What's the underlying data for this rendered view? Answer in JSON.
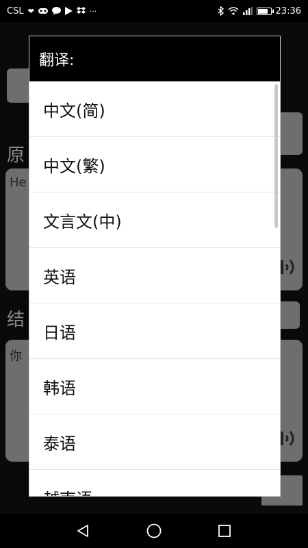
{
  "status_bar": {
    "carrier": "CSL",
    "notification_icons": [
      "heart-icon",
      "gamepad-icon",
      "chat-bubble-icon",
      "play-icon",
      "dropbox-icon"
    ],
    "more_indicator": "···",
    "time": "23:36",
    "battery_level": 0.7
  },
  "background": {
    "source_label": "原",
    "source_text": "He",
    "result_label": "结",
    "result_text": "你"
  },
  "dialog": {
    "title": "翻译:",
    "options": [
      "中文(简)",
      "中文(繁)",
      "文言文(中)",
      "英语",
      "日语",
      "韩语",
      "泰语",
      "越南语"
    ]
  },
  "nav_bar": {
    "buttons": [
      "back-icon",
      "home-icon",
      "recents-icon"
    ]
  }
}
